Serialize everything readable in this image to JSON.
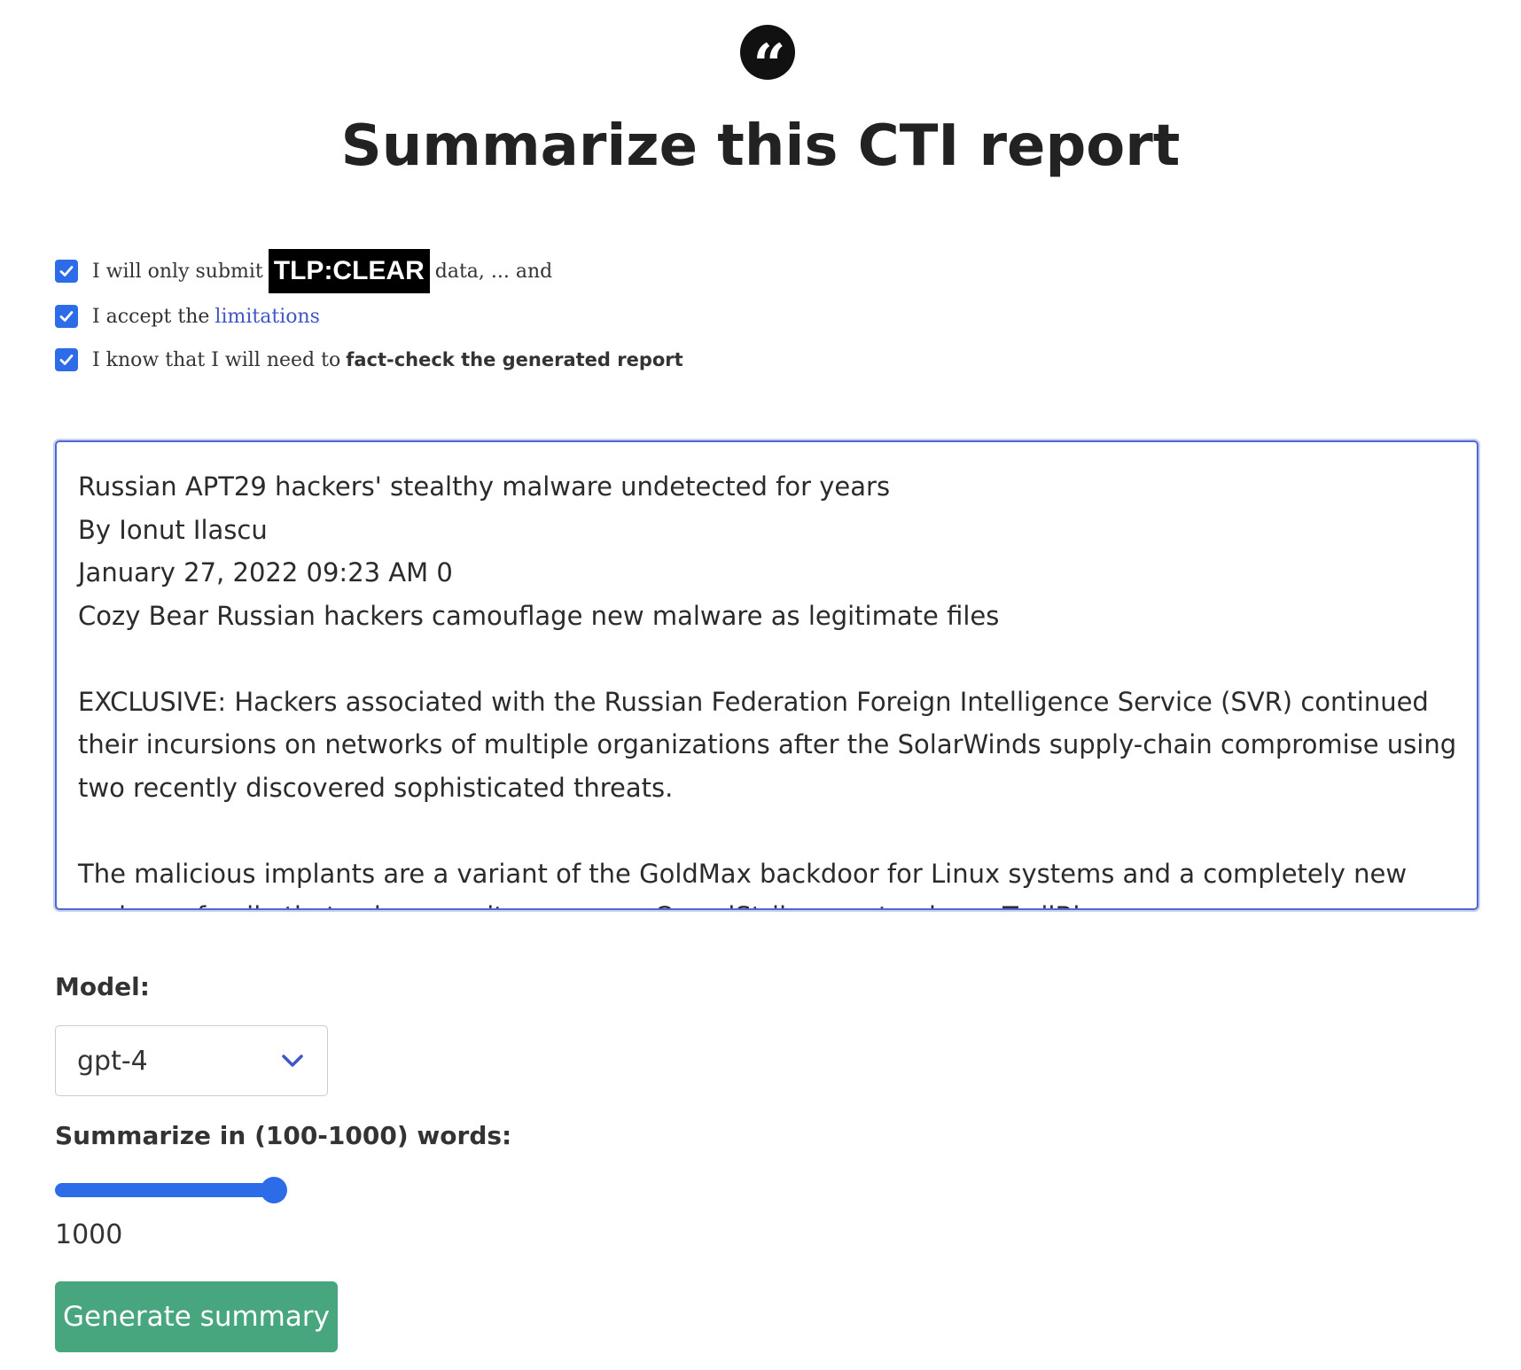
{
  "header": {
    "logo_glyph": "“",
    "title": "Summarize this CTI report"
  },
  "checkboxes": [
    {
      "checked": true,
      "before": "I will only submit",
      "badge": "TLP:CLEAR",
      "after": "data, ... and"
    },
    {
      "checked": true,
      "before": "I accept the",
      "link": "limitations"
    },
    {
      "checked": true,
      "before": "I know that I will need to",
      "bold": "fact-check the generated report"
    }
  ],
  "report": {
    "text": "Russian APT29 hackers' stealthy malware undetected for years\nBy Ionut Ilascu\nJanuary 27, 2022 09:23 AM 0\nCozy Bear Russian hackers camouflage new malware as legitimate files\n\nEXCLUSIVE: Hackers associated with the Russian Federation Foreign Intelligence Service (SVR) continued their incursions on networks of multiple organizations after the SolarWinds supply-chain compromise using two recently discovered sophisticated threats.\n\nThe malicious implants are a variant of the GoldMax backdoor for Linux systems and a completely new malware family that cybersecurity company CrowdStrike now tracks as TrailBlazer."
  },
  "model": {
    "label": "Model:",
    "selected": "gpt-4",
    "icon": "chevron-down-icon"
  },
  "words": {
    "label": "Summarize in (100-1000) words:",
    "min": 100,
    "max": 1000,
    "value": 1000,
    "value_text": "1000"
  },
  "actions": {
    "generate_label": "Generate summary"
  },
  "colors": {
    "accent": "#2d6ce8",
    "link": "#4056c8",
    "button": "#48a67f",
    "focus_border": "#5069d2"
  }
}
